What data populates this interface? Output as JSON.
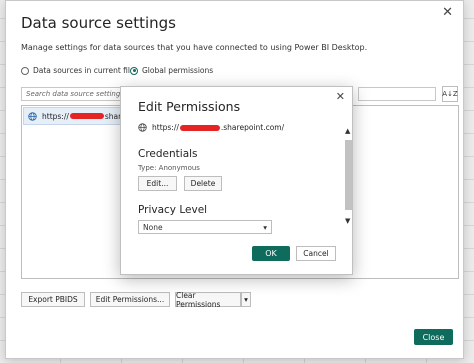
{
  "dialog": {
    "title": "Data source settings",
    "close_glyph": "✕",
    "description": "Manage settings for data sources that you have connected to using Power BI Desktop.",
    "radio_current": "Data sources in current file",
    "radio_global": "Global permissions",
    "search_placeholder": "Search data source settings",
    "sort_glyph": "A↓Z",
    "list": [
      {
        "prefix": "https://",
        "suffix": "sharep"
      }
    ],
    "buttons": {
      "export": "Export PBIDS",
      "edit_permissions": "Edit Permissions...",
      "clear_permissions": "Clear Permissions",
      "clear_dropdown": "▾",
      "close": "Close"
    }
  },
  "modal": {
    "title": "Edit Permissions",
    "close_glyph": "✕",
    "url_prefix": "https://",
    "url_suffix": ".sharepoint.com/",
    "credentials_heading": "Credentials",
    "credential_type": "Type: Anonymous",
    "edit_button": "Edit...",
    "delete_button": "Delete",
    "privacy_heading": "Privacy Level",
    "privacy_value": "None",
    "privacy_caret": "▾",
    "ok_button": "OK",
    "cancel_button": "Cancel",
    "scroll_up": "▲",
    "scroll_down": "▼"
  },
  "colors": {
    "accent": "#0f6b5c",
    "redaction": "#e52424"
  },
  "icons": [
    "globe-icon",
    "close-icon",
    "sort-icon",
    "chevron-down-icon"
  ]
}
